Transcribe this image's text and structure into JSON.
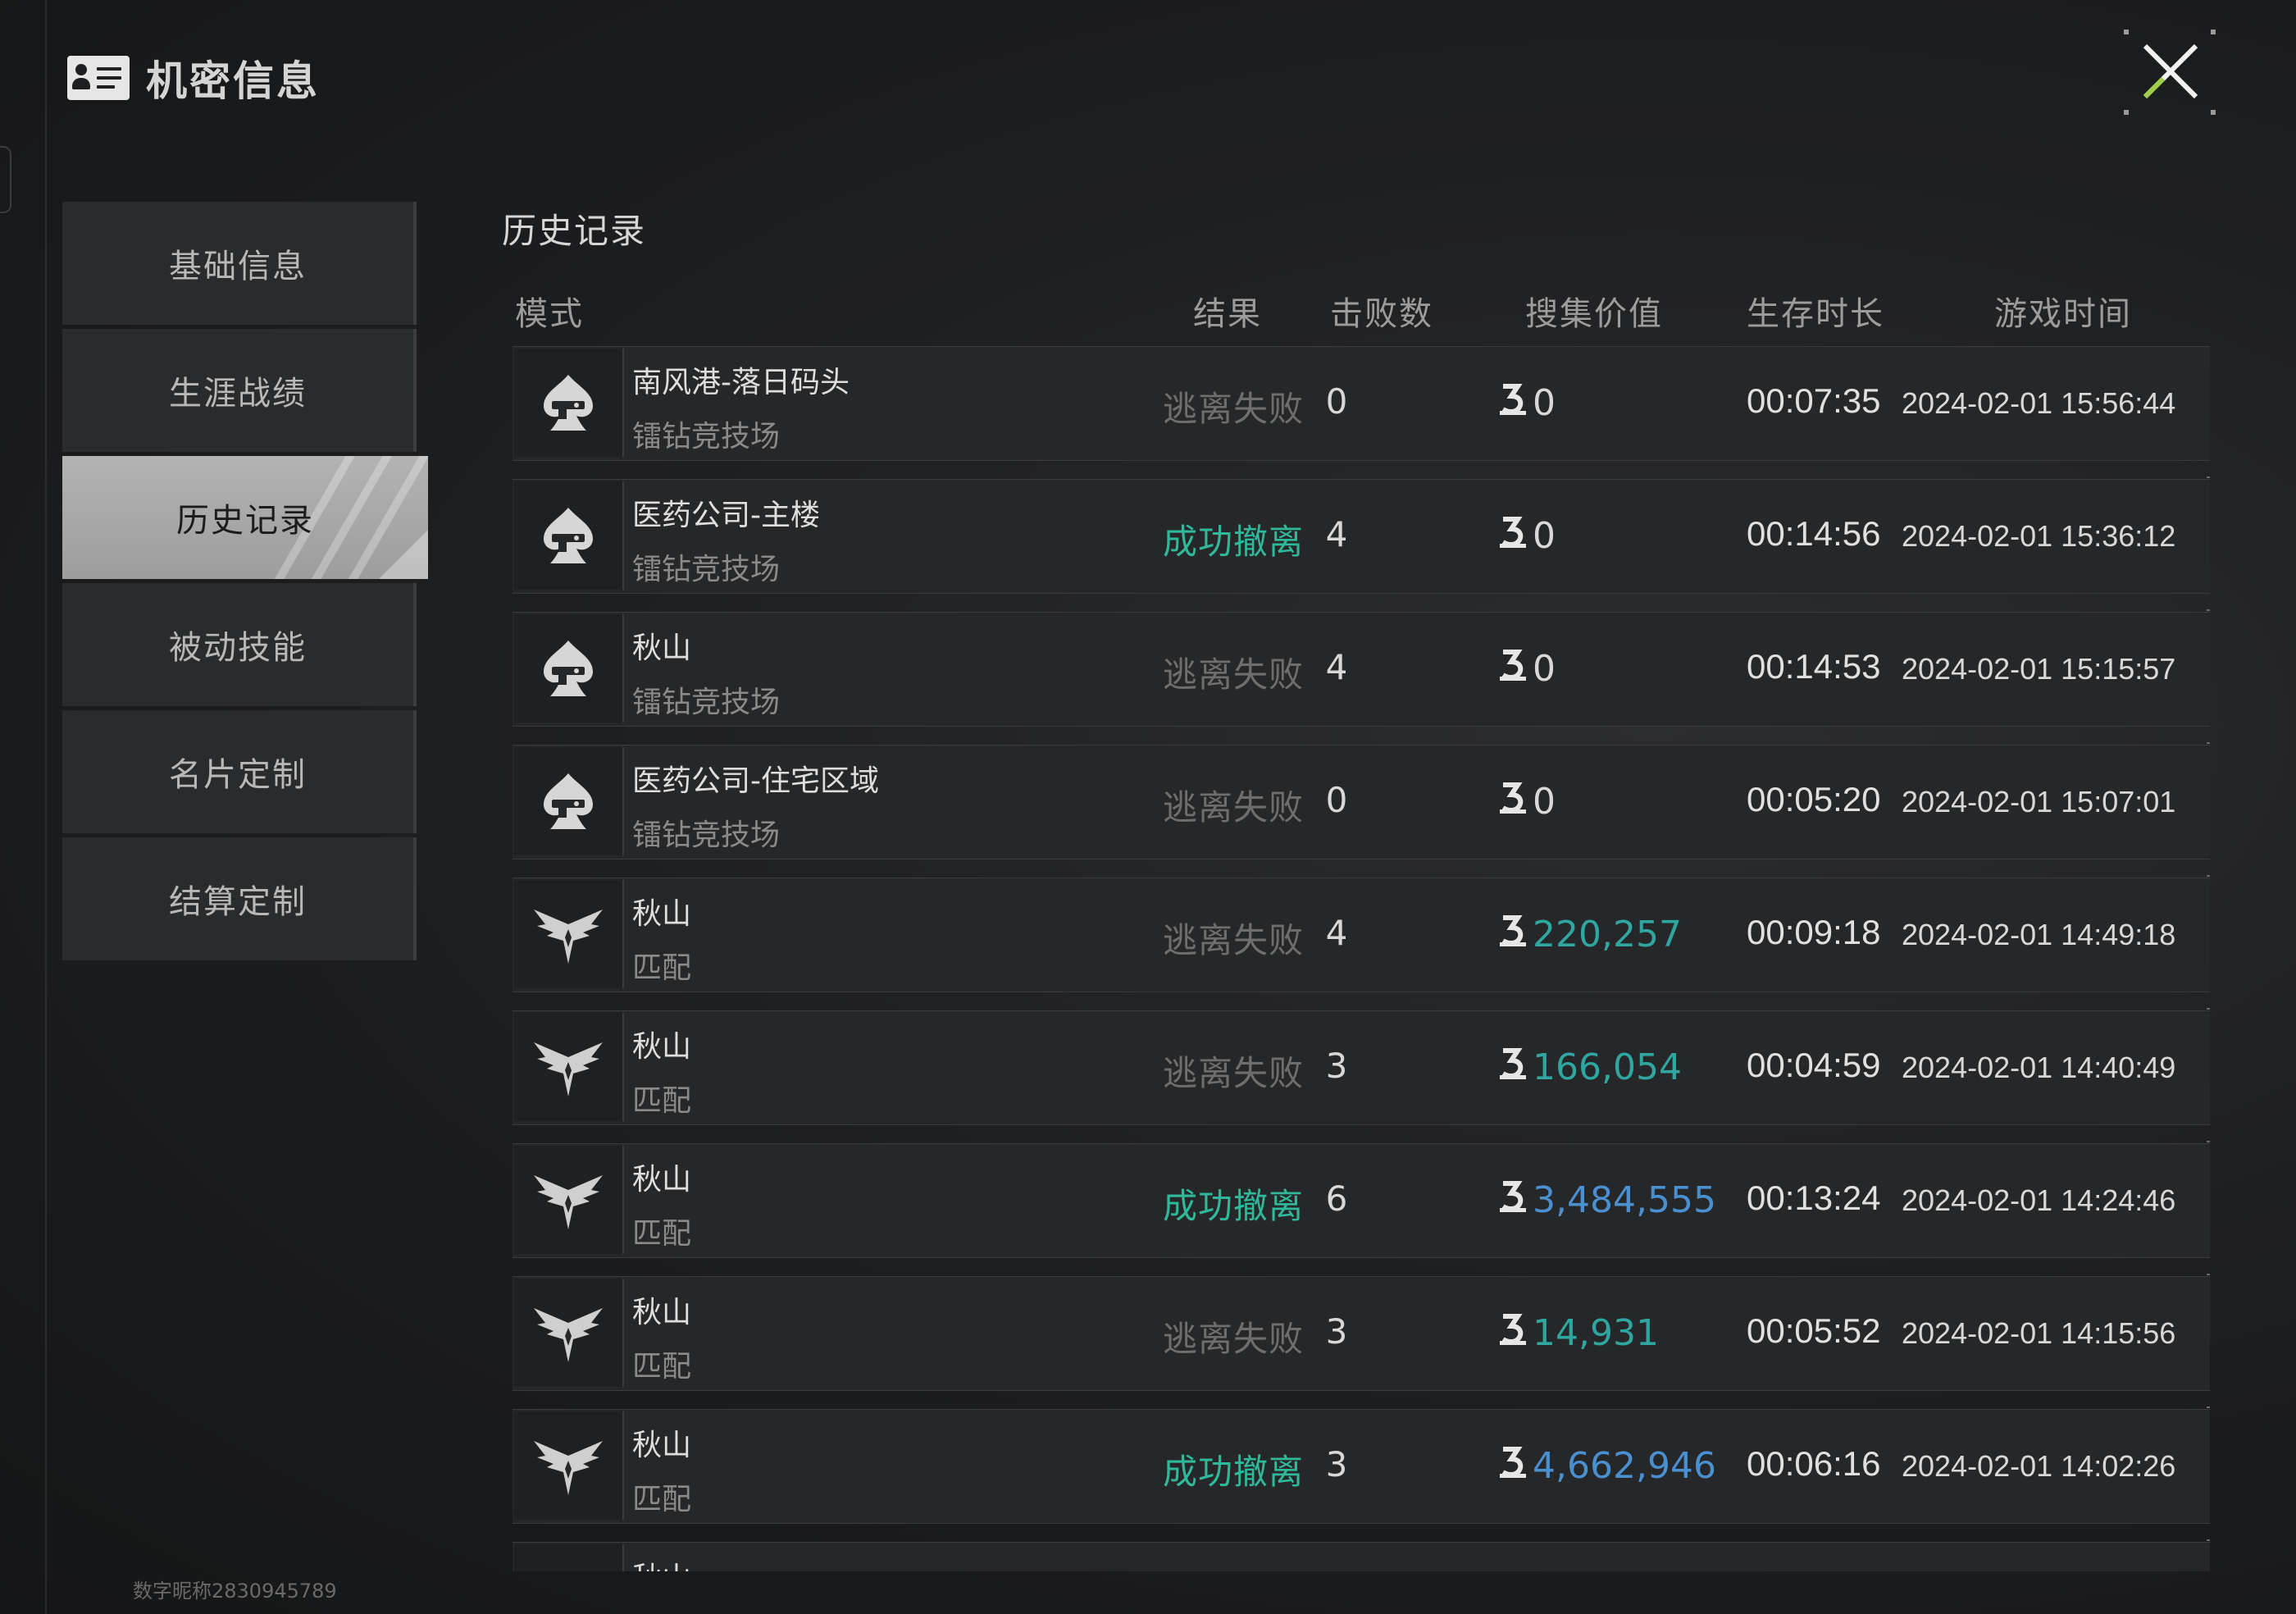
{
  "header": {
    "title": "机密信息",
    "icon": "id-card-icon"
  },
  "close_icon": "close-icon",
  "sidebar": {
    "items": [
      {
        "label": "基础信息",
        "active": false
      },
      {
        "label": "生涯战绩",
        "active": false
      },
      {
        "label": "历史记录",
        "active": true
      },
      {
        "label": "被动技能",
        "active": false
      },
      {
        "label": "名片定制",
        "active": false
      },
      {
        "label": "结算定制",
        "active": false
      }
    ]
  },
  "footer": {
    "player_id": "数字昵称2830945789"
  },
  "history": {
    "title": "历史记录",
    "columns": {
      "mode": "模式",
      "result": "结果",
      "kills": "击败数",
      "value": "搜集价值",
      "survival": "生存时长",
      "time": "游戏时间"
    },
    "rows": [
      {
        "icon": "spade-gun-icon",
        "map": "南风港-落日码头",
        "mode": "镭钻竞技场",
        "result": "逃离失败",
        "result_success": false,
        "kills": "0",
        "value": "0",
        "survival": "00:07:35",
        "time": "2024-02-01 15:56:44"
      },
      {
        "icon": "spade-gun-icon",
        "map": "医药公司-主楼",
        "mode": "镭钻竞技场",
        "result": "成功撤离",
        "result_success": true,
        "kills": "4",
        "value": "0",
        "survival": "00:14:56",
        "time": "2024-02-01 15:36:12"
      },
      {
        "icon": "spade-gun-icon",
        "map": "秋山",
        "mode": "镭钻竞技场",
        "result": "逃离失败",
        "result_success": false,
        "kills": "4",
        "value": "0",
        "survival": "00:14:53",
        "time": "2024-02-01 15:15:57"
      },
      {
        "icon": "spade-gun-icon",
        "map": "医药公司-住宅区域",
        "mode": "镭钻竞技场",
        "result": "逃离失败",
        "result_success": false,
        "kills": "0",
        "value": "0",
        "survival": "00:05:20",
        "time": "2024-02-01 15:07:01"
      },
      {
        "icon": "eagle-wings-icon",
        "map": "秋山",
        "mode": "匹配",
        "result": "逃离失败",
        "result_success": false,
        "kills": "4",
        "value": "220,257",
        "survival": "00:09:18",
        "time": "2024-02-01 14:49:18"
      },
      {
        "icon": "eagle-wings-icon",
        "map": "秋山",
        "mode": "匹配",
        "result": "逃离失败",
        "result_success": false,
        "kills": "3",
        "value": "166,054",
        "survival": "00:04:59",
        "time": "2024-02-01 14:40:49"
      },
      {
        "icon": "eagle-wings-icon",
        "map": "秋山",
        "mode": "匹配",
        "result": "成功撤离",
        "result_success": true,
        "kills": "6",
        "value": "3,484,555",
        "survival": "00:13:24",
        "time": "2024-02-01 14:24:46"
      },
      {
        "icon": "eagle-wings-icon",
        "map": "秋山",
        "mode": "匹配",
        "result": "逃离失败",
        "result_success": false,
        "kills": "3",
        "value": "14,931",
        "survival": "00:05:52",
        "time": "2024-02-01 14:15:56"
      },
      {
        "icon": "eagle-wings-icon",
        "map": "秋山",
        "mode": "匹配",
        "result": "成功撤离",
        "result_success": true,
        "kills": "3",
        "value": "4,662,946",
        "survival": "00:06:16",
        "time": "2024-02-01 14:02:26"
      },
      {
        "icon": "eagle-wings-icon",
        "map": "秋山",
        "mode": "",
        "result": "",
        "result_success": false,
        "kills": "",
        "value": "",
        "survival": "",
        "time": ""
      }
    ]
  },
  "colors": {
    "success": "#2fb89a",
    "fail": "#6e6e6e",
    "value_positive": "#2fa6a0",
    "value_large": "#4a8fd0",
    "active_tab": "#b3b3b3"
  }
}
